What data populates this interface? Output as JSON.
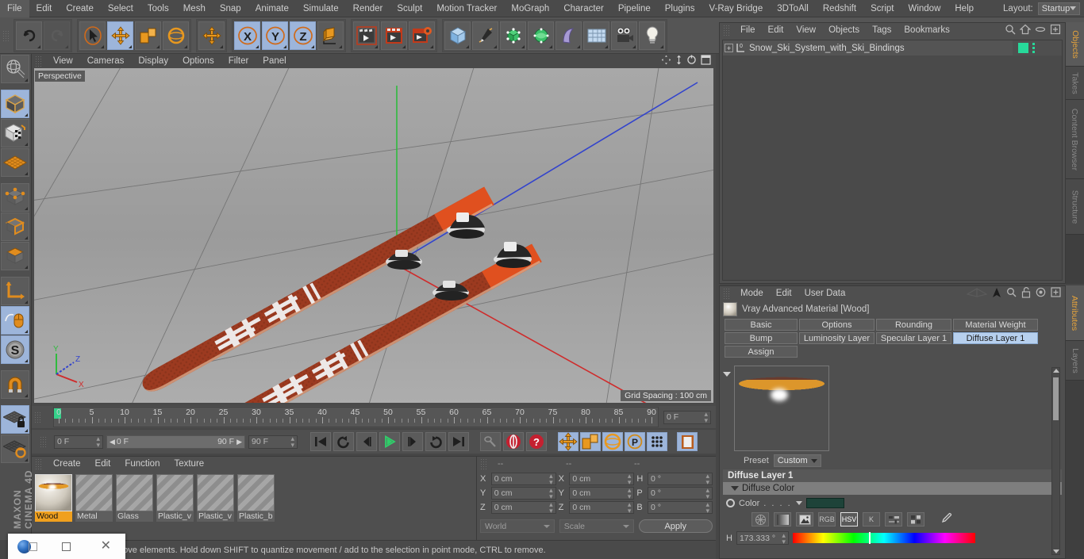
{
  "app": {
    "title": "CINEMA 4D",
    "brand_top": "MAXON"
  },
  "menu": {
    "items": [
      "File",
      "Edit",
      "Create",
      "Select",
      "Tools",
      "Mesh",
      "Snap",
      "Animate",
      "Simulate",
      "Render",
      "Sculpt",
      "Motion Tracker",
      "MoGraph",
      "Character",
      "Pipeline",
      "Plugins",
      "V-Ray Bridge",
      "3DToAll",
      "Redshift",
      "Script",
      "Window",
      "Help"
    ],
    "layout_label": "Layout:",
    "layout_value": "Startup"
  },
  "toolbar": {
    "groups": [
      {
        "name": "history",
        "buttons": [
          {
            "name": "undo-button",
            "icon": "undo-icon",
            "active": false,
            "dim": false
          },
          {
            "name": "redo-button",
            "icon": "redo-icon",
            "active": false,
            "dim": true
          }
        ]
      },
      {
        "name": "tools",
        "buttons": [
          {
            "name": "live-selection-button",
            "icon": "selection-arrow-icon",
            "active": false,
            "dim": false
          },
          {
            "name": "move-button",
            "icon": "move-cross-icon",
            "active": true,
            "dim": false
          },
          {
            "name": "scale-button",
            "icon": "scale-box-icon",
            "active": false,
            "dim": false
          },
          {
            "name": "rotate-button",
            "icon": "rotate-ring-icon",
            "active": false,
            "dim": false
          }
        ]
      },
      {
        "name": "axis-lock-single",
        "buttons": [
          {
            "name": "world-axis-button",
            "icon": "move-cross-icon",
            "active": false,
            "dim": false
          }
        ]
      },
      {
        "name": "axis-locks",
        "buttons": [
          {
            "name": "lock-x-button",
            "icon": "x-axis-icon",
            "label": "X",
            "active": true,
            "dim": false
          },
          {
            "name": "lock-y-button",
            "icon": "y-axis-icon",
            "label": "Y",
            "active": true,
            "dim": false
          },
          {
            "name": "lock-z-button",
            "icon": "z-axis-icon",
            "label": "Z",
            "active": true,
            "dim": false
          },
          {
            "name": "coordinate-system-button",
            "icon": "world-object-cube-icon",
            "active": false,
            "dim": false
          }
        ]
      },
      {
        "name": "render",
        "buttons": [
          {
            "name": "render-view-button",
            "icon": "clapper-view-icon",
            "active": false,
            "dim": false
          },
          {
            "name": "render-to-picture-viewer-button",
            "icon": "clapper-picture-icon",
            "active": false,
            "dim": false
          },
          {
            "name": "render-settings-button",
            "icon": "clapper-gear-icon",
            "active": false,
            "dim": false
          }
        ]
      },
      {
        "name": "create",
        "buttons": [
          {
            "name": "add-cube-button",
            "icon": "cube-icon",
            "active": false,
            "dim": false
          },
          {
            "name": "add-spline-button",
            "icon": "pen-spline-icon",
            "active": false,
            "dim": false
          },
          {
            "name": "add-generator-button",
            "icon": "generator-green-cube-icon",
            "active": false,
            "dim": false
          },
          {
            "name": "add-deformer-button",
            "icon": "deformer-green-icon",
            "active": false,
            "dim": false
          },
          {
            "name": "add-scene-object-button",
            "icon": "environment-icon",
            "active": false,
            "dim": false
          },
          {
            "name": "add-sky-button",
            "icon": "sky-grid-icon",
            "active": false,
            "dim": false
          },
          {
            "name": "add-camera-button",
            "icon": "camera-icon",
            "active": false,
            "dim": false
          },
          {
            "name": "add-light-button",
            "icon": "light-bulb-icon",
            "active": false,
            "dim": false
          }
        ]
      }
    ]
  },
  "left_toolbar": {
    "buttons": [
      {
        "name": "make-editable-button",
        "icon": "globe-mesh-icon",
        "active": false
      },
      {
        "name": "model-mode-button",
        "icon": "model-cube-icon",
        "active": true
      },
      {
        "name": "texture-mode-button",
        "icon": "texture-cube-icon",
        "active": false
      },
      {
        "name": "workplane-button",
        "icon": "workplane-grid-icon",
        "active": false
      },
      {
        "name": "points-mode-button",
        "icon": "points-cube-icon",
        "active": false
      },
      {
        "name": "edges-mode-button",
        "icon": "edges-cube-icon",
        "active": false
      },
      {
        "name": "polygons-mode-button",
        "icon": "polygons-cube-icon",
        "active": false
      },
      {
        "name": "object-axis-button",
        "icon": "axis-l-icon",
        "active": false
      },
      {
        "name": "enable-viewport-snap-button",
        "icon": "mouse-snap-icon",
        "active": true
      },
      {
        "name": "soft-selection-button",
        "icon": "s-circle-icon",
        "active": true
      },
      {
        "name": "magnet-button",
        "icon": "magnet-icon",
        "active": false
      },
      {
        "name": "lock-workplane-button",
        "icon": "workplane-lock-icon",
        "active": true
      },
      {
        "name": "planar-workplane-button",
        "icon": "workplane-rotate-icon",
        "active": false
      }
    ]
  },
  "viewport": {
    "menu": [
      "View",
      "Cameras",
      "Display",
      "Options",
      "Filter",
      "Panel"
    ],
    "label": "Perspective",
    "grid_spacing": "Grid Spacing : 100 cm",
    "axis_labels": {
      "x": "X",
      "y": "Y",
      "z": "Z"
    },
    "corner_icons": [
      "pan-icon",
      "move-vertical-icon",
      "rotate-icon",
      "maximize-icon"
    ]
  },
  "timeline": {
    "ticks": [
      0,
      5,
      10,
      15,
      20,
      25,
      30,
      35,
      40,
      45,
      50,
      55,
      60,
      65,
      70,
      75,
      80,
      85,
      90
    ],
    "current_frame_field": "0 F",
    "start_frame": "0 F",
    "range_start": "0 F",
    "range_end": "90 F",
    "end_frame": "90 F",
    "transport_buttons": [
      {
        "name": "go-to-start-button",
        "icon": "skip-start-icon"
      },
      {
        "name": "play-backwards-loop-button",
        "icon": "loop-back-icon"
      },
      {
        "name": "previous-frame-button",
        "icon": "step-back-icon"
      },
      {
        "name": "play-button",
        "icon": "play-icon"
      },
      {
        "name": "next-frame-button",
        "icon": "step-forward-icon"
      },
      {
        "name": "loop-forward-button",
        "icon": "loop-forward-icon"
      },
      {
        "name": "go-to-end-button",
        "icon": "skip-end-icon"
      }
    ],
    "record_buttons": [
      {
        "name": "autokeying-button",
        "icon": "key-icon"
      },
      {
        "name": "record-active-objects-button",
        "icon": "record-red-icon"
      },
      {
        "name": "record-question-button",
        "icon": "record-question-icon"
      }
    ],
    "key_toggle_buttons": [
      {
        "name": "key-position-button",
        "icon": "move-cross-icon"
      },
      {
        "name": "key-scale-button",
        "icon": "scale-box-icon"
      },
      {
        "name": "key-rotation-button",
        "icon": "rotate-ring-icon"
      },
      {
        "name": "key-parameter-button",
        "icon": "p-circle-icon"
      },
      {
        "name": "key-point-level-animation-button",
        "icon": "pla-dots-icon"
      }
    ],
    "timeline_toggle_button": {
      "name": "timeline-mode-button",
      "icon": "film-strip-icon"
    }
  },
  "materials": {
    "menu": [
      "Create",
      "Edit",
      "Function",
      "Texture"
    ],
    "items": [
      {
        "name": "Wood",
        "selected": true,
        "has_preview": true
      },
      {
        "name": "Metal",
        "selected": false,
        "has_preview": false
      },
      {
        "name": "Glass",
        "selected": false,
        "has_preview": false
      },
      {
        "name": "Plastic_v",
        "selected": false,
        "has_preview": false
      },
      {
        "name": "Plastic_v",
        "selected": false,
        "has_preview": false
      },
      {
        "name": "Plastic_b",
        "selected": false,
        "has_preview": false
      }
    ]
  },
  "coordinates": {
    "header_cells": [
      "--",
      "--",
      "--"
    ],
    "rows": [
      {
        "pos_label": "X",
        "pos_value": "0 cm",
        "size_label": "X",
        "size_value": "0 cm",
        "rot_label": "H",
        "rot_value": "0 °"
      },
      {
        "pos_label": "Y",
        "pos_value": "0 cm",
        "size_label": "Y",
        "size_value": "0 cm",
        "rot_label": "P",
        "rot_value": "0 °"
      },
      {
        "pos_label": "Z",
        "pos_value": "0 cm",
        "size_label": "Z",
        "size_value": "0 cm",
        "rot_label": "B",
        "rot_value": "0 °"
      }
    ],
    "system": "World",
    "mode": "Scale",
    "apply_label": "Apply"
  },
  "object_manager": {
    "menu": [
      "File",
      "Edit",
      "View",
      "Objects",
      "Tags",
      "Bookmarks"
    ],
    "icons": [
      "search-icon",
      "home-icon",
      "ellipse-icon",
      "plus-box-icon"
    ],
    "rows": [
      {
        "name": "Snow_Ski_System_with_Ski_Bindings",
        "level_badge": "0",
        "tag_color": "#27d99a"
      }
    ]
  },
  "attributes": {
    "menu": [
      "Mode",
      "Edit",
      "User Data"
    ],
    "icons": [
      "animate-path-icon",
      "cursor-arrow-icon",
      "search-icon",
      "unlock-icon",
      "target-icon",
      "plus-box-icon"
    ],
    "material_title": "Vray Advanced Material [Wood]",
    "tabs_row1": [
      {
        "label": "Basic",
        "active": false
      },
      {
        "label": "Options",
        "active": false
      },
      {
        "label": "Rounding",
        "active": false
      },
      {
        "label": "Material Weight",
        "active": false
      }
    ],
    "tabs_row2": [
      {
        "label": "Bump",
        "active": false
      },
      {
        "label": "Luminosity Layer",
        "active": false
      },
      {
        "label": "Specular Layer 1",
        "active": false
      },
      {
        "label": "Diffuse Layer 1",
        "active": true
      }
    ],
    "tabs_row3": [
      {
        "label": "Assign",
        "active": false
      }
    ],
    "preset_label": "Preset",
    "preset_value": "Custom",
    "section_title": "Diffuse Layer 1",
    "subsection_title": "Diffuse Color",
    "color_label": "Color",
    "color_dots": ". . . .",
    "color_swatch": "#1e4339",
    "color_mode_buttons": [
      {
        "label": "",
        "name": "color-wheel-button",
        "active": false
      },
      {
        "label": "",
        "name": "gradient-button",
        "active": false
      },
      {
        "label": "",
        "name": "image-picker-button",
        "active": false
      },
      {
        "label": "RGB",
        "name": "rgb-mode-button",
        "active": false
      },
      {
        "label": "HSV",
        "name": "hsv-mode-button",
        "active": true
      },
      {
        "label": "K",
        "name": "kelvin-mode-button",
        "active": false
      },
      {
        "label": "",
        "name": "sliders-button",
        "active": false
      },
      {
        "label": "",
        "name": "swatches-button",
        "active": false
      },
      {
        "label": "",
        "name": "eyedropper-button",
        "active": false
      }
    ],
    "hue_label": "H",
    "hue_value": "173.333 °"
  },
  "dock_tabs_top": [
    "Objects",
    "Takes",
    "Content Browser",
    "Structure"
  ],
  "dock_tabs_bottom": [
    "Attributes",
    "Layers"
  ],
  "status_bar": {
    "text": "move elements. Hold down SHIFT to quantize movement / add to the selection in point mode, CTRL to remove."
  },
  "taskbar": {
    "items": [
      {
        "name": "cinema4d-taskbar-icon",
        "icon": "c4d-logo-icon"
      },
      {
        "name": "maximize-window-button",
        "icon": "square-icon"
      },
      {
        "name": "close-window-button",
        "icon": "close-x-icon"
      }
    ]
  },
  "scene": {
    "description": "Two red/orange skis with white graphics and black-and-white ski bindings on a grey ground plane",
    "ski_color": "#a63c22",
    "ski_tip_color": "#e8542a",
    "binding_color": "#1c1c1c",
    "ground_color": "#9e9e9e"
  }
}
